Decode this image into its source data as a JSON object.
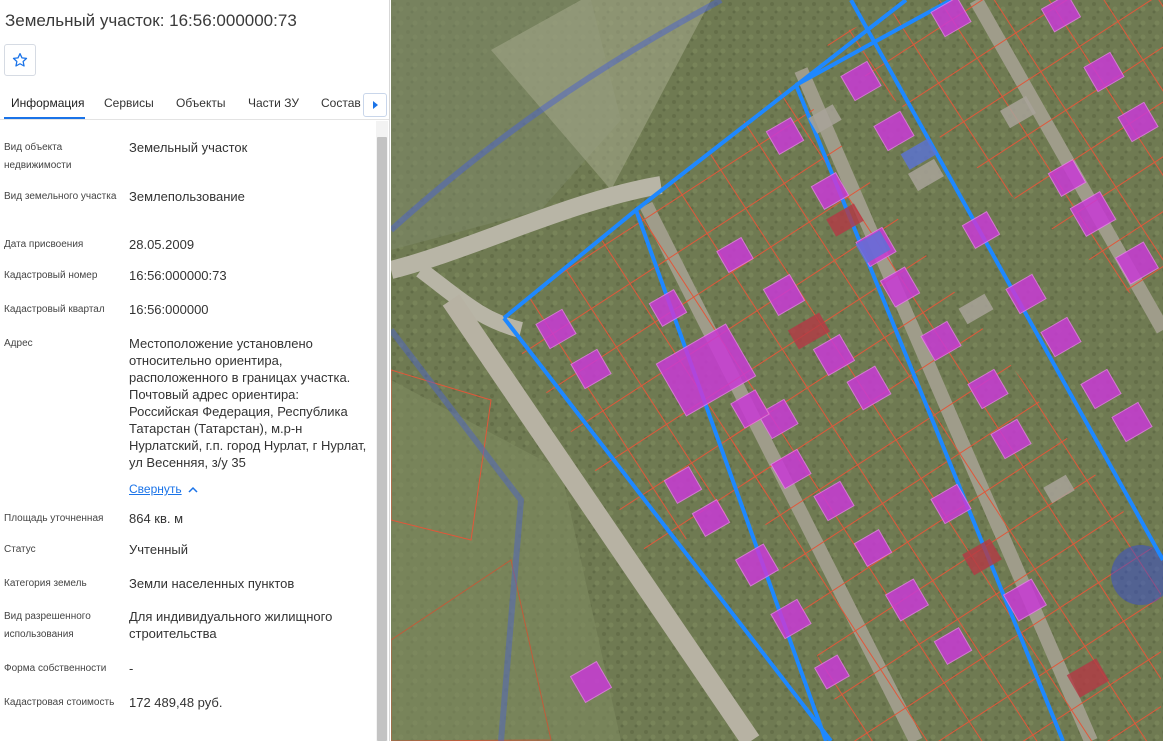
{
  "title": "Земельный участок: 16:56:000000:73",
  "tabs": [
    "Информация",
    "Сервисы",
    "Объекты",
    "Части ЗУ",
    "Состав"
  ],
  "fields": {
    "object_type": {
      "label": "Вид объекта недвижимости",
      "value": "Земельный участок"
    },
    "land_type": {
      "label": "Вид земельного участка",
      "value": "Землепользование"
    },
    "assign_date": {
      "label": "Дата присвоения",
      "value": "28.05.2009"
    },
    "cad_number": {
      "label": "Кадастровый номер",
      "value": "16:56:000000:73"
    },
    "cad_quarter": {
      "label": "Кадастровый квартал",
      "value": "16:56:000000"
    },
    "address": {
      "label": "Адрес",
      "value": "Местоположение установлено относительно ориентира, расположенного в границах участка. Почтовый адрес ориентира: Российская Федерация, Республика Татарстан (Татарстан), м.р-н Нурлатский, г.п. город Нурлат, г Нурлат, ул Весенняя, з/у 35"
    },
    "area": {
      "label": "Площадь уточненная",
      "value": "864 кв. м"
    },
    "status": {
      "label": "Статус",
      "value": "Учтенный"
    },
    "category": {
      "label": "Категория земель",
      "value": "Земли населенных пунктов"
    },
    "permitted_use": {
      "label": "Вид разрешенного использования",
      "value": "Для индивидуального жилищного строительства"
    },
    "ownership": {
      "label": "Форма собственности",
      "value": "-"
    },
    "cad_value": {
      "label": "Кадастровая стоимость",
      "value": "172 489,48 руб."
    }
  },
  "collapse_label": "Свернуть",
  "colors": {
    "accent": "#1a73e8",
    "parcel_border": "#1e88ff",
    "building_fill": "#c93ad6",
    "lot_line": "#e0573a"
  }
}
